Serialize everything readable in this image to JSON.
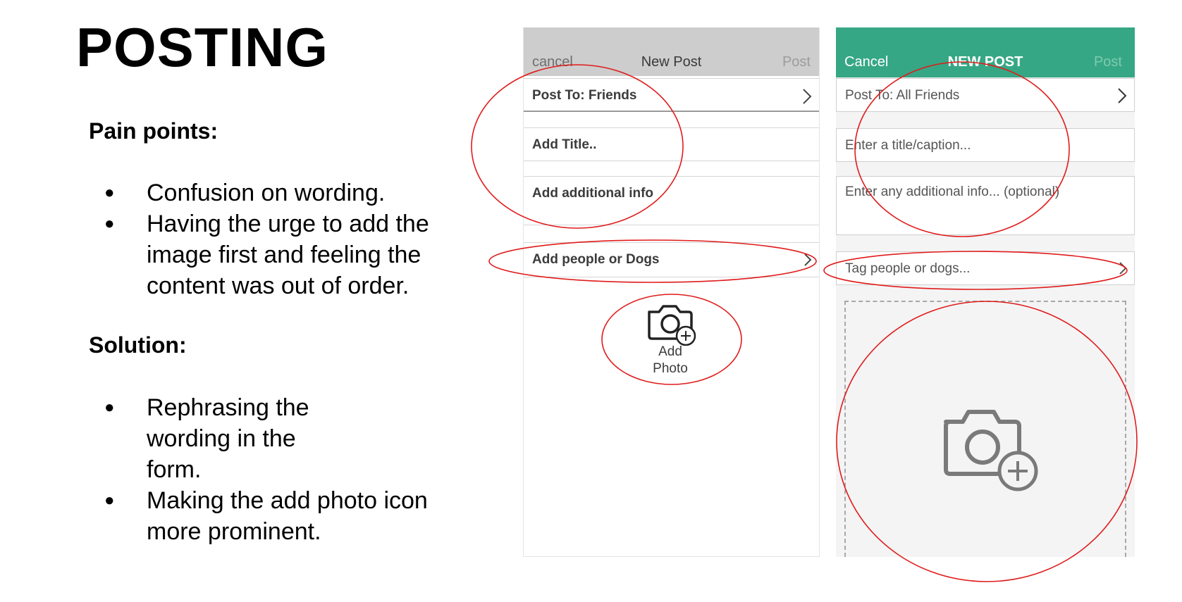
{
  "slide": {
    "title": "POSTING",
    "pain_points": {
      "heading": "Pain points:",
      "items": [
        "Confusion on wording.",
        "Having the urge to add the image first and feeling the content was out of order."
      ]
    },
    "solution": {
      "heading": "Solution:",
      "items": [
        "Rephrasing the wording in the form.",
        "Making the add photo icon more prominent."
      ]
    },
    "bullet_glyph": "●"
  },
  "old_form": {
    "nav": {
      "cancel": "cancel",
      "title": "New Post",
      "post": "Post"
    },
    "post_to": "Post To: Friends",
    "title_field": "Add Title..",
    "info_field": "Add additional info",
    "tag_field": "Add people or Dogs",
    "add_photo": [
      "Add",
      "Photo"
    ],
    "colors": {
      "nav_bg": "#cdcdcd"
    },
    "icons": [
      "chevron-right-icon",
      "camera-add-icon"
    ]
  },
  "new_form": {
    "nav": {
      "cancel": "Cancel",
      "title": "NEW POST",
      "post": "Post"
    },
    "post_to": "Post To: All Friends",
    "title_field": "Enter a title/caption...",
    "info_field": "Enter any additional info... (optional)",
    "tag_field": "Tag people or dogs...",
    "colors": {
      "nav_bg": "#36a784"
    },
    "icons": [
      "chevron-right-icon",
      "camera-add-icon"
    ]
  },
  "annotations": {
    "color": "#e01b1b",
    "shape": "ellipse"
  }
}
